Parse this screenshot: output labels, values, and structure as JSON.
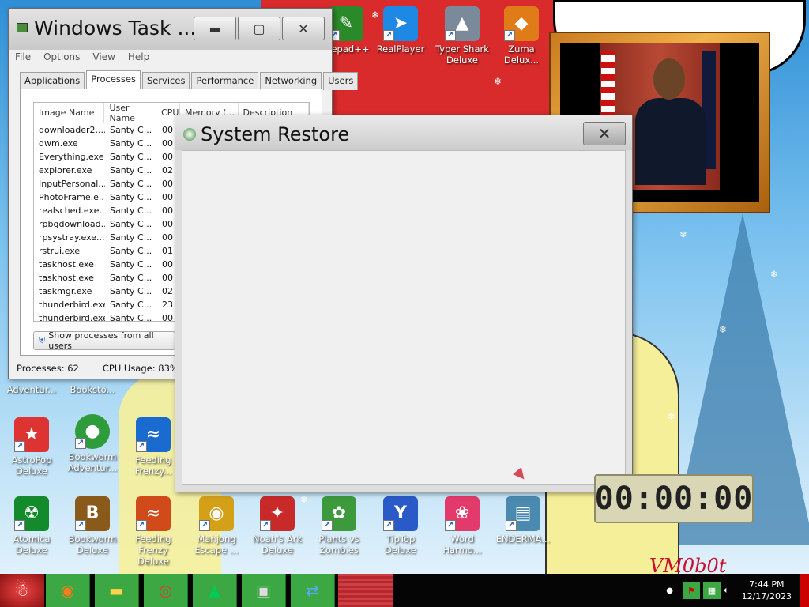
{
  "desktop": {
    "icons": [
      {
        "label": "...epad++",
        "glyph": "✎",
        "color": "#2a8a2a"
      },
      {
        "label": "RealPlayer",
        "glyph": "➤",
        "color": "#1e88e5"
      },
      {
        "label": "Typer Shark Deluxe",
        "glyph": "▲",
        "color": "#7a8a9a"
      },
      {
        "label": "Zuma Delux...",
        "glyph": "◆",
        "color": "#e07b1a"
      },
      {
        "label": "Adventur...",
        "glyph": "",
        "color": "transparent"
      },
      {
        "label": "Booksto...",
        "glyph": "",
        "color": "transparent"
      },
      {
        "label": "AstroPop Deluxe",
        "glyph": "★",
        "color": "#d33"
      },
      {
        "label": "Bookworm Adventur...",
        "glyph": "●",
        "color": "#2e9c3b"
      },
      {
        "label": "Feeding Frenzy...",
        "glyph": "≈",
        "color": "#1a6bd0"
      },
      {
        "label": "Atomica Deluxe",
        "glyph": "☢",
        "color": "#138a2c"
      },
      {
        "label": "Bookworm Deluxe",
        "glyph": "B",
        "color": "#8a5a1a"
      },
      {
        "label": "Feeding Frenzy Deluxe",
        "glyph": "≈",
        "color": "#d04a1a"
      },
      {
        "label": "Mahjong Escape ...",
        "glyph": "◉",
        "color": "#d4a017"
      },
      {
        "label": "Noah's Ark Deluxe",
        "glyph": "✦",
        "color": "#c82a2a"
      },
      {
        "label": "Plants vs Zombies",
        "glyph": "✿",
        "color": "#3c9a3c"
      },
      {
        "label": "TipTop Deluxe",
        "glyph": "Y",
        "color": "#2a5ac8"
      },
      {
        "label": "Word Harmo...",
        "glyph": "❀",
        "color": "#e23a6a"
      },
      {
        "label": "ENDERMA...",
        "glyph": "▤",
        "color": "#4a8ab0"
      }
    ],
    "watermark": "VM0b0t"
  },
  "task_manager": {
    "title": "Windows Task ...",
    "menu": [
      "File",
      "Options",
      "View",
      "Help"
    ],
    "tabs": [
      "Applications",
      "Processes",
      "Services",
      "Performance",
      "Networking",
      "Users"
    ],
    "active_tab": "Processes",
    "columns": [
      "Image Name",
      "User Name",
      "CPU",
      "Memory (...",
      "Description"
    ],
    "rows": [
      [
        "downloader2....",
        "Santy C...",
        "00"
      ],
      [
        "dwm.exe",
        "Santy C...",
        "00"
      ],
      [
        "Everything.exe",
        "Santy C...",
        "00"
      ],
      [
        "explorer.exe",
        "Santy C...",
        "02"
      ],
      [
        "InputPersonal...",
        "Santy C...",
        "00"
      ],
      [
        "PhotoFrame.e...",
        "Santy C...",
        "00"
      ],
      [
        "realsched.exe...",
        "Santy C...",
        "00"
      ],
      [
        "rpbgdownload...",
        "Santy C...",
        "00"
      ],
      [
        "rpsystray.exe...",
        "Santy C...",
        "00"
      ],
      [
        "rstrui.exe",
        "Santy C...",
        "01"
      ],
      [
        "taskhost.exe",
        "Santy C...",
        "00"
      ],
      [
        "taskhost.exe",
        "Santy C...",
        "00"
      ],
      [
        "taskmgr.exe",
        "Santy C...",
        "02"
      ],
      [
        "thunderbird.exe",
        "Santy C...",
        "23"
      ],
      [
        "thunderbird.exe",
        "Santy C...",
        "00"
      ]
    ],
    "show_all_label": "Show processes from all users",
    "processes_label": "Processes: 62",
    "cpu_label": "CPU Usage: 83%"
  },
  "system_restore": {
    "title": "System Restore"
  },
  "gadget": {
    "time": "00:00:00"
  },
  "taskbar": {
    "buttons": [
      "firefox-icon",
      "explorer-icon",
      "chrome-icon",
      "tree-icon",
      "computer-icon",
      "network-icon"
    ],
    "time": "7:44 PM",
    "date": "12/17/2023"
  }
}
